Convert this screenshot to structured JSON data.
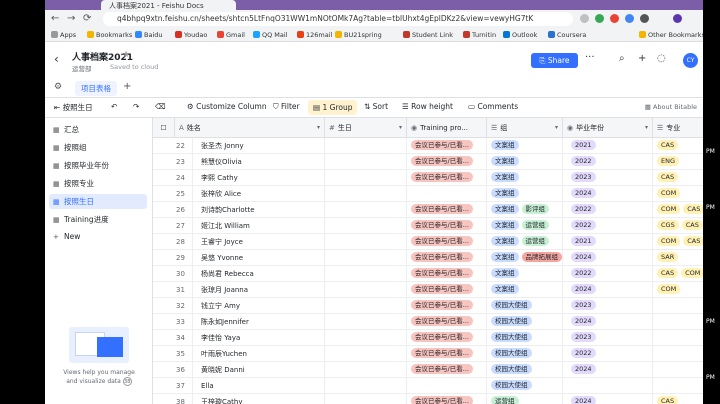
{
  "browser": {
    "tab_title": "人事档案2021 - Feishu Docs",
    "url": "q4bhpq9xtn.feishu.cn/sheets/shtcn5LtFnqO31WW1mNOtOMk7Ag?table=tblUhxt4gEplDKz2&view=vewyHG7tK",
    "bookmarks": [
      "Apps",
      "Bookmarks",
      "Baidu",
      "Youdao",
      "Gmail",
      "QQ Mail",
      "126mail",
      "BU21spring",
      "Student Link",
      "Turnitin",
      "Outlook",
      "Coursera",
      "Other Bookmarks"
    ]
  },
  "header": {
    "title": "人事档案2021",
    "folder": "运营部",
    "save_status": "Saved to cloud",
    "share_label": "Share",
    "avatar_initials": "CY"
  },
  "tabs": {
    "active": "项目表格"
  },
  "toolbar": {
    "collapse_label": "按照生日",
    "customize_label": "Customize Column",
    "filter_label": "Filter",
    "group_label": "1 Group",
    "sort_label": "Sort",
    "row_height_label": "Row height",
    "comments_label": "Comments",
    "about_label": "About Bitable"
  },
  "sidebar": {
    "items": [
      {
        "label": "汇总",
        "active": false
      },
      {
        "label": "按照组",
        "active": false
      },
      {
        "label": "按照毕业年份",
        "active": false
      },
      {
        "label": "按照专业",
        "active": false
      },
      {
        "label": "按照生日",
        "active": true
      },
      {
        "label": "Training进度",
        "active": false
      }
    ],
    "new_label": "New",
    "promo_text": "Views help you manage and visualize data",
    "promo_badge": "38"
  },
  "table": {
    "columns": [
      "姓名",
      "生日",
      "Training pro...",
      "组",
      "毕业年份",
      "专业"
    ],
    "rows": [
      {
        "num": "22",
        "name": "张圣杰 Jonny",
        "training": "会议已参与/已看...",
        "groups": [
          "文案组"
        ],
        "year": "2021",
        "majors": [
          "CAS"
        ]
      },
      {
        "num": "23",
        "name": "熊慧仪Olivia",
        "training": "会议已参与/已看...",
        "groups": [
          "文案组"
        ],
        "year": "2022",
        "majors": [
          "ENG"
        ]
      },
      {
        "num": "24",
        "name": "李熙 Cathy",
        "training": "会议已参与/已看...",
        "groups": [
          "文案组"
        ],
        "year": "2023",
        "majors": [
          "CAS"
        ]
      },
      {
        "num": "25",
        "name": "张梓欣 Alice",
        "training": "",
        "groups": [
          "文案组"
        ],
        "year": "2024",
        "majors": [
          "COM"
        ]
      },
      {
        "num": "26",
        "name": "刘诗韵Charlotte",
        "training": "会议已参与/已看...",
        "groups": [
          "文案组",
          "影评组"
        ],
        "year": "2022",
        "majors": [
          "COM",
          "CAS"
        ]
      },
      {
        "num": "27",
        "name": "姬江北 William",
        "training": "会议已参与/已看...",
        "groups": [
          "文案组",
          "运营组"
        ],
        "year": "2022",
        "majors": [
          "CGS",
          "CAS"
        ]
      },
      {
        "num": "28",
        "name": "王睿宁 Joyce",
        "training": "会议已参与/已看...",
        "groups": [
          "文案组",
          "运营组"
        ],
        "year": "2021",
        "majors": [
          "COM",
          "CAS"
        ]
      },
      {
        "num": "29",
        "name": "吴悠 Yvonne",
        "training": "会议已参与/已看...",
        "groups": [
          "文案组",
          "品牌拓展组"
        ],
        "year": "2024",
        "majors": [
          "SAR"
        ]
      },
      {
        "num": "30",
        "name": "杨尚君 Rebecca",
        "training": "会议已参与/已看...",
        "groups": [
          "文案组"
        ],
        "year": "2022",
        "majors": [
          "CAS",
          "COM"
        ]
      },
      {
        "num": "31",
        "name": "张琼月 Joanna",
        "training": "会议已参与/已看...",
        "groups": [
          "文案组"
        ],
        "year": "2024",
        "majors": [
          "COM"
        ]
      },
      {
        "num": "32",
        "name": "钱立宁 Amy",
        "training": "会议已参与/已看...",
        "groups": [
          "校园大使组"
        ],
        "year": "2023",
        "majors": []
      },
      {
        "num": "33",
        "name": "陈永如Jennifer",
        "training": "会议已参与/已看...",
        "groups": [
          "校园大使组"
        ],
        "year": "2024",
        "majors": []
      },
      {
        "num": "34",
        "name": "李佳怡 Yaya",
        "training": "会议已参与/已看...",
        "groups": [
          "校园大使组"
        ],
        "year": "2023",
        "majors": []
      },
      {
        "num": "35",
        "name": "叶雨辰Yuchen",
        "training": "会议已参与/已看...",
        "groups": [
          "校园大使组"
        ],
        "year": "2022",
        "majors": []
      },
      {
        "num": "36",
        "name": "黄晓妮 Danni",
        "training": "会议已参与/已看...",
        "groups": [
          "校园大使组"
        ],
        "year": "2024",
        "majors": []
      },
      {
        "num": "37",
        "name": "Ella",
        "training": "",
        "groups": [
          "校园大使组"
        ],
        "year": "",
        "majors": []
      },
      {
        "num": "38",
        "name": "王梓璇Cathy",
        "training": "会议已参与/已看...",
        "groups": [
          "运营组"
        ],
        "year": "2024",
        "majors": [
          "CAS"
        ]
      }
    ]
  },
  "colors": {
    "accent": "#3370ff",
    "training_tag_bg": "#f8c4c0",
    "group_tag_bg": "#c9dcff",
    "group_tag_green_bg": "#c6efd4",
    "group_tag_red_bg": "#f5a5a0",
    "year_tag_bg": "#e2d9fb",
    "major_tag_bg": "#fff0b3"
  },
  "right_edge": {
    "labels": [
      "PM",
      "PM",
      "PM",
      "PM"
    ]
  }
}
